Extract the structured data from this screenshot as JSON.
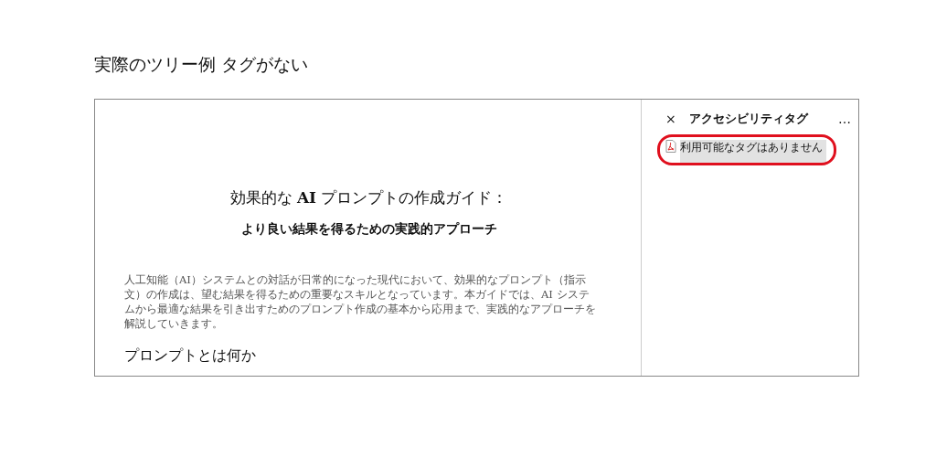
{
  "caption": "実際のツリー例 タグがない",
  "document": {
    "title": "効果的な **AI** プロンプトの作成ガイド：",
    "subtitle": "より良い結果を得るための実践的アプローチ",
    "paragraph": "人工知能（AI）システムとの対話が日常的になった現代において、効果的なプロンプト（指示文）の作成は、望む結果を得るための重要なスキルとなっています。本ガイドでは、AI システムから最適な結果を引き出すためのプロンプト作成の基本から応用まで、実践的なアプローチを解説していきます。",
    "section_heading": "プロンプトとは何か"
  },
  "panel": {
    "close": "×",
    "title": "アクセシビリティタグ",
    "more": "…",
    "items": [
      {
        "label": "利用可能なタグはありません",
        "selected": true,
        "highlighted": true
      }
    ]
  }
}
